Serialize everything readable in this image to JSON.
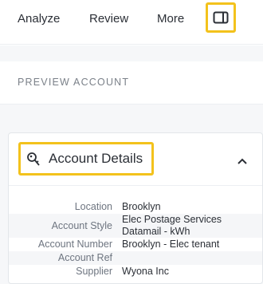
{
  "nav": {
    "analyze": "Analyze",
    "review": "Review",
    "more": "More"
  },
  "section": {
    "preview_label": "PREVIEW ACCOUNT"
  },
  "card": {
    "title": "Account Details",
    "rows": [
      {
        "label": "Location",
        "value": "Brooklyn"
      },
      {
        "label": "Account Style",
        "value": "Elec Postage Services Datamail - kWh"
      },
      {
        "label": "Account Number",
        "value": "Brooklyn - Elec tenant"
      },
      {
        "label": "Account Ref",
        "value": ""
      },
      {
        "label": "Supplier",
        "value": "Wyona Inc"
      }
    ]
  },
  "colors": {
    "highlight": "#f3c21c",
    "text": "#2b2f36",
    "muted": "#7b8189",
    "background": "#f6f7f9"
  },
  "icons": [
    "panel-toggle-icon",
    "key-icon",
    "chevron-up-icon"
  ]
}
